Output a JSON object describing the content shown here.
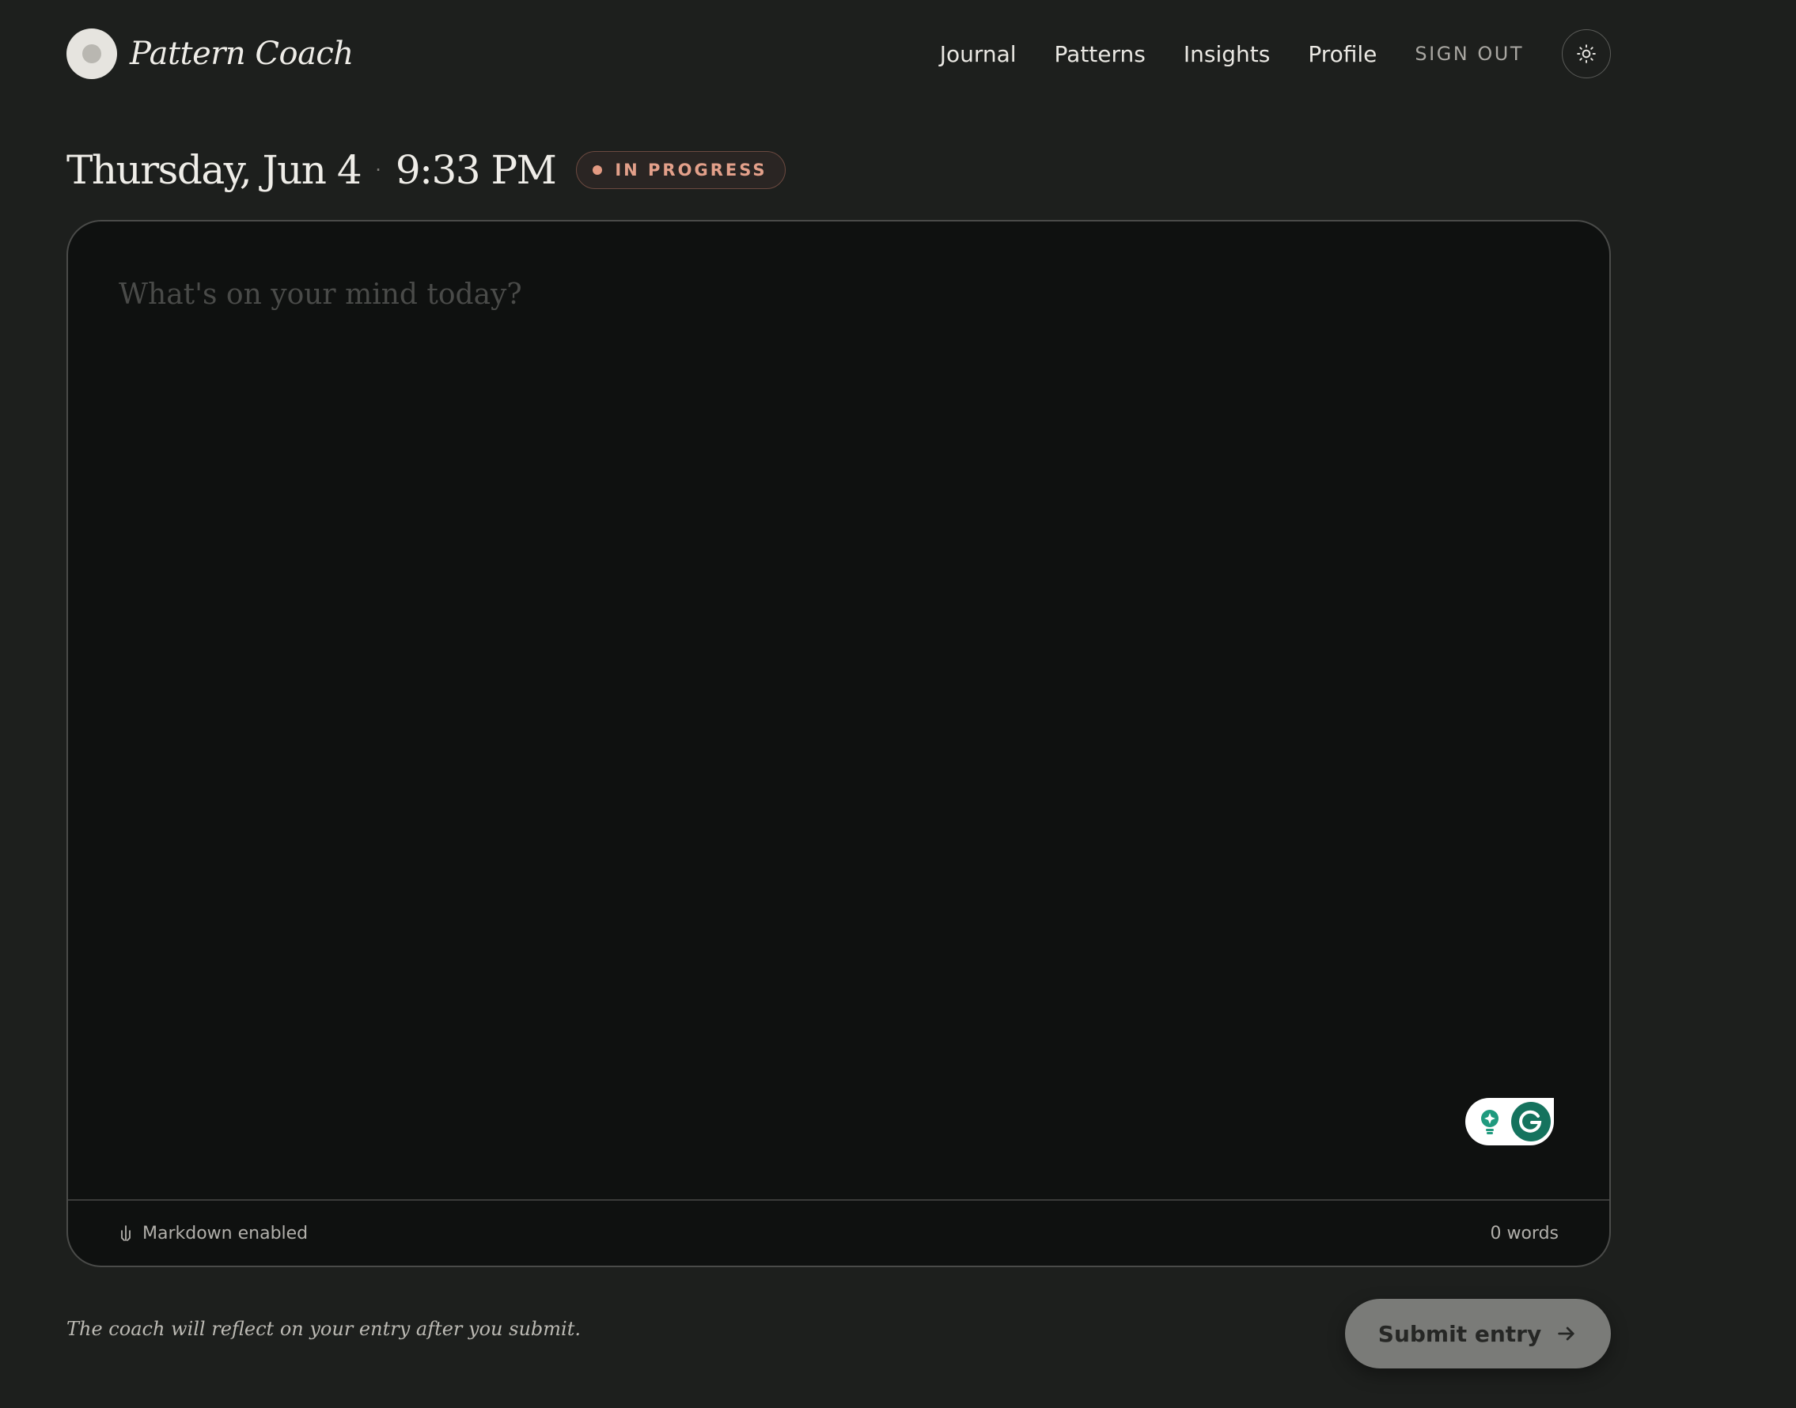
{
  "brand": {
    "name": "Pattern Coach",
    "logo_icon": "circle-logo-icon"
  },
  "nav": {
    "items": [
      {
        "label": "Journal"
      },
      {
        "label": "Patterns"
      },
      {
        "label": "Insights"
      },
      {
        "label": "Profile"
      }
    ],
    "sign_out": "SIGN OUT",
    "theme_toggle_icon": "sun-icon"
  },
  "entry": {
    "date": "Thursday, Jun 4",
    "separator": "·",
    "time": "9:33 PM",
    "status": "IN PROGRESS",
    "status_color": "#e39a82"
  },
  "editor": {
    "placeholder": "What's on your mind today?",
    "value": "",
    "footer": {
      "markdown_label": "Markdown enabled",
      "markdown_icon": "markdown-icon",
      "word_count": "0 words"
    }
  },
  "footer": {
    "note": "The coach will reflect on your entry after you submit.",
    "submit_label": "Submit entry",
    "submit_icon": "arrow-right-icon"
  },
  "colors": {
    "background": "#1d1f1d",
    "editor_bg": "#0f1110",
    "submit_bg": "#7a7b78",
    "grammarly": "#15735e"
  }
}
